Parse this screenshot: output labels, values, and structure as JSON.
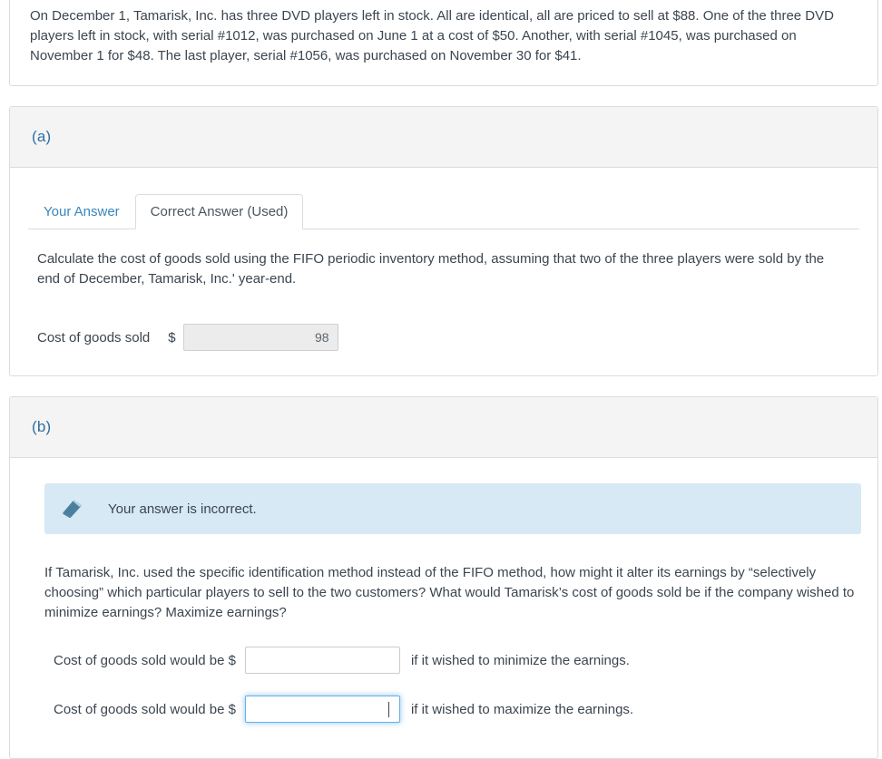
{
  "problem": {
    "text": "On December 1, Tamarisk, Inc. has three DVD players left in stock. All are identical, all are priced to sell at $88. One of the three DVD players left in stock, with serial #1012, was purchased on June 1 at a cost of $50. Another, with serial #1045, was purchased on November 1 for $48. The last player, serial #1056, was purchased on November 30 for $41."
  },
  "part_a": {
    "label": "(a)",
    "tabs": [
      {
        "label": "Your Answer",
        "active": false
      },
      {
        "label": "Correct Answer (Used)",
        "active": true
      }
    ],
    "question": "Calculate the cost of goods sold using the FIFO periodic inventory method, assuming that two of the three players were sold by the end of December, Tamarisk, Inc.' year-end.",
    "answer_row": {
      "label": "Cost of goods sold",
      "currency": "$",
      "value": "98",
      "placeholder": ""
    }
  },
  "part_b": {
    "label": "(b)",
    "alert": {
      "icon": "eraser-icon",
      "text": "Your answer is incorrect.",
      "background": "#d6e9f4",
      "icon_color": "#4b7f9e"
    },
    "question": "If Tamarisk, Inc. used the specific identification method instead of the FIFO method, how might it alter its earnings by “selectively choosing” which particular players to sell to the two customers? What would Tamarisk’s cost of goods sold be if the company wished to minimize earnings? Maximize earnings?",
    "rows": [
      {
        "label": "Cost of goods sold would be $",
        "value": "",
        "placeholder": "",
        "suffix": "if it wished to minimize the earnings.",
        "focused": false
      },
      {
        "label": "Cost of goods sold would be $",
        "value": "",
        "placeholder": "",
        "suffix": "if it wished to maximize the earnings.",
        "focused": true
      }
    ]
  },
  "colors": {
    "accent_blue": "#2f6fa3",
    "link_blue": "#3a86bd",
    "focus_blue": "#66afe9",
    "header_grey": "#f4f4f4",
    "border_grey": "#dcdcdc",
    "text": "#3b454f"
  }
}
